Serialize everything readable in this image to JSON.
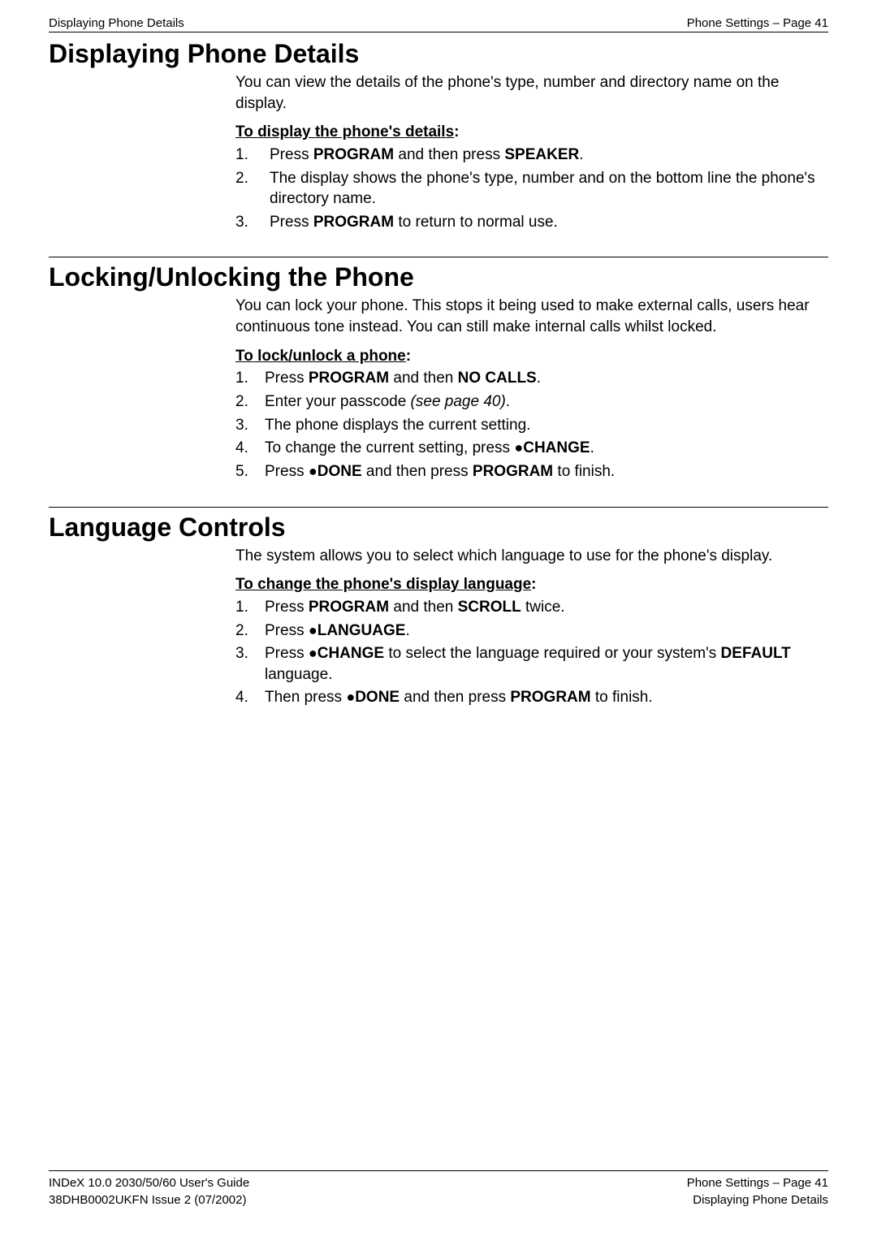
{
  "header": {
    "left": "Displaying Phone Details",
    "right": "Phone Settings – Page 41"
  },
  "section1": {
    "title": "Displaying Phone Details",
    "intro": "You can view the details of the phone's type, number and directory name on the display.",
    "subheading_underline": "To display the phone's details",
    "subheading_colon": ":",
    "steps": {
      "s1_num": "1.",
      "s1_a": "Press ",
      "s1_b": "PROGRAM",
      "s1_c": " and then press ",
      "s1_d": "SPEAKER",
      "s1_e": ".",
      "s2_num": "2.",
      "s2_a": "The display shows the phone's type, number and on the bottom line the phone's directory name.",
      "s3_num": "3.",
      "s3_a": "Press ",
      "s3_b": "PROGRAM",
      "s3_c": " to return to normal use."
    }
  },
  "section2": {
    "title": "Locking/Unlocking the Phone",
    "intro": "You can lock your phone. This stops it being used to make external calls, users hear continuous tone instead. You can still make internal calls whilst locked.",
    "subheading_underline": "To lock/unlock a phone",
    "subheading_colon": ":",
    "steps": {
      "s1_num": "1.",
      "s1_a": "Press ",
      "s1_b": "PROGRAM",
      "s1_c": " and then ",
      "s1_d": "NO CALLS",
      "s1_e": ".",
      "s2_num": "2.",
      "s2_a": "Enter your passcode ",
      "s2_b": "(see page 40)",
      "s2_c": ".",
      "s3_num": "3.",
      "s3_a": "The phone displays the current setting.",
      "s4_num": "4.",
      "s4_a": "To change the current setting, press ",
      "s4_bullet": "●",
      "s4_b": "CHANGE",
      "s4_c": ".",
      "s5_num": "5.",
      "s5_a": "Press ",
      "s5_bullet": "●",
      "s5_b": "DONE",
      "s5_c": " and then press ",
      "s5_d": "PROGRAM",
      "s5_e": " to finish."
    }
  },
  "section3": {
    "title": "Language Controls",
    "intro": "The system allows you to select which language to use for the phone's display.",
    "subheading_underline": "To change the phone's display language",
    "subheading_colon": ":",
    "steps": {
      "s1_num": "1.",
      "s1_a": "Press ",
      "s1_b": "PROGRAM",
      "s1_c": " and then ",
      "s1_d": "SCROLL",
      "s1_e": " twice.",
      "s2_num": "2.",
      "s2_a": "Press ",
      "s2_bullet": "●",
      "s2_b": "LANGUAGE",
      "s2_c": ".",
      "s3_num": "3.",
      "s3_a": "Press ",
      "s3_bullet": "●",
      "s3_b": "CHANGE",
      "s3_c": " to select the language required or your system's ",
      "s3_d": "DEFAULT",
      "s3_e": " language.",
      "s4_num": "4.",
      "s4_a": "Then press ",
      "s4_bullet": "●",
      "s4_b": "DONE",
      "s4_c": " and then press ",
      "s4_d": "PROGRAM",
      "s4_e": " to finish."
    }
  },
  "footer": {
    "left1": "INDeX 10.0 2030/50/60 User's Guide",
    "left2": "38DHB0002UKFN Issue 2 (07/2002)",
    "right1": "Phone Settings – Page 41",
    "right2": "Displaying Phone Details"
  }
}
